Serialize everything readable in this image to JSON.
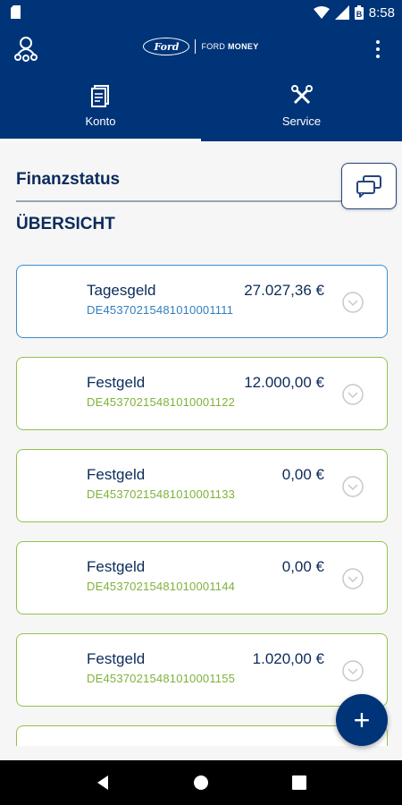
{
  "status_bar": {
    "time": "8:58"
  },
  "header": {
    "brand_logo": "Ford",
    "brand_product_prefix": "FORD",
    "brand_product_name": "MONEY",
    "icons": {
      "left": "user-network-icon",
      "right": "more-vert-icon"
    }
  },
  "tabs": [
    {
      "label": "Konto",
      "icon": "document-icon",
      "active": true
    },
    {
      "label": "Service",
      "icon": "tools-icon",
      "active": false
    }
  ],
  "main": {
    "finance_title": "Finanzstatus",
    "section_title": "ÜBERSICHT"
  },
  "accounts": [
    {
      "name": "Tagesgeld",
      "amount": "27.027,36 €",
      "iban": "DE45370215481010001111",
      "accent": "#3a8dd1"
    },
    {
      "name": "Festgeld",
      "amount": "12.000,00 €",
      "iban": "DE45370215481010001122",
      "accent": "#93c24b"
    },
    {
      "name": "Festgeld",
      "amount": "0,00 €",
      "iban": "DE45370215481010001133",
      "accent": "#93c24b"
    },
    {
      "name": "Festgeld",
      "amount": "0,00 €",
      "iban": "DE45370215481010001144",
      "accent": "#93c24b"
    },
    {
      "name": "Festgeld",
      "amount": "1.020,00 €",
      "iban": "DE45370215481010001155",
      "accent": "#93c24b"
    }
  ],
  "fab": {
    "label": "+"
  },
  "colors": {
    "primary": "#003478",
    "text_dark": "#0b2b5b",
    "green": "#93c24b",
    "blue": "#3a8dd1"
  }
}
